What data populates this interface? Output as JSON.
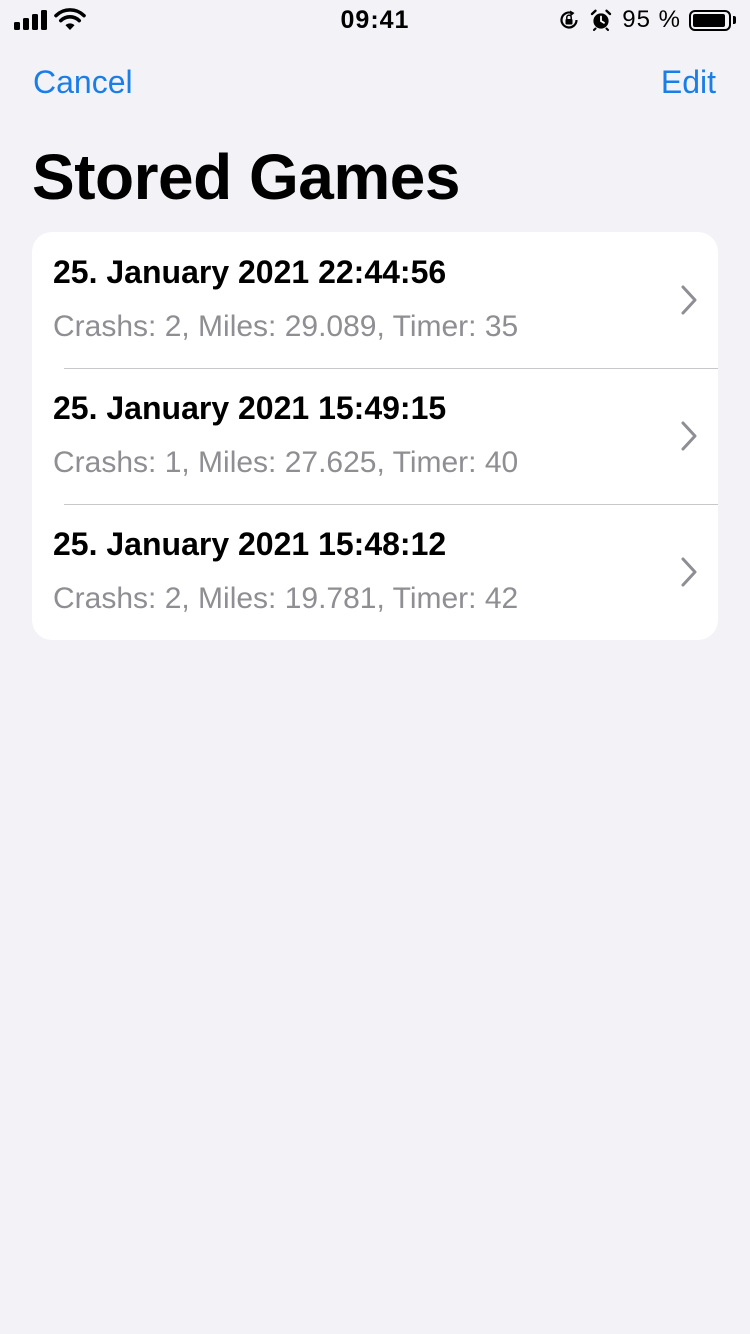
{
  "status_bar": {
    "time": "09:41",
    "battery_percent_text": "95 %",
    "battery_level": 0.95
  },
  "nav": {
    "left_label": "Cancel",
    "right_label": "Edit",
    "accent_color": "#1a7ee8"
  },
  "title": "Stored Games",
  "games": [
    {
      "date": "25. January 2021 22:44:56",
      "summary": "Crashs: 2, Miles: 29.089, Timer: 35"
    },
    {
      "date": "25. January 2021 15:49:15",
      "summary": "Crashs: 1, Miles: 27.625, Timer: 40"
    },
    {
      "date": "25. January 2021 15:48:12",
      "summary": "Crashs: 2, Miles: 19.781, Timer: 42"
    }
  ],
  "icons": {
    "signal": "cellular-signal-icon",
    "wifi": "wifi-icon",
    "rotation_lock": "rotation-lock-icon",
    "alarm": "alarm-icon",
    "battery": "battery-icon",
    "row_accessory": "chevron-right-icon"
  }
}
